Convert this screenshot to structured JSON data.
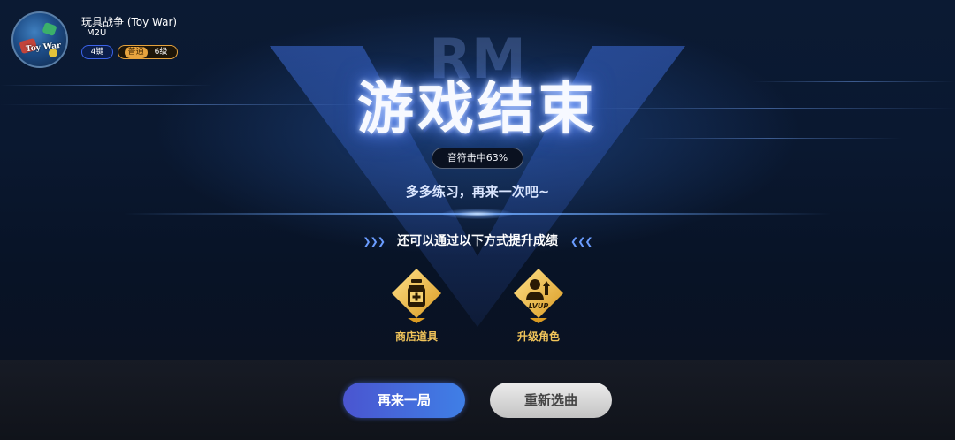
{
  "song": {
    "title": "玩具战争 (Toy War)",
    "artist": "M2U",
    "cover_text": "Toy War",
    "keys_tag": "4键",
    "difficulty_label": "普通",
    "difficulty_level": "6级"
  },
  "result": {
    "title": "游戏结束",
    "hit_rate": "音符击中63%",
    "message": "多多练习，再来一次吧~"
  },
  "tips": {
    "heading": "还可以通过以下方式提升成绩",
    "chevrons_left": "❯❯❯",
    "chevrons_right": "❮❮❮",
    "items": [
      {
        "label": "商店道具",
        "icon": "potion-bottle-icon"
      },
      {
        "label": "升级角色",
        "icon": "level-up-icon",
        "badge_text": "LVUP"
      }
    ]
  },
  "background_logo": "RM",
  "buttons": {
    "retry": "再来一局",
    "reselect": "重新选曲"
  },
  "colors": {
    "accent_gold": "#f1c45a",
    "accent_blue": "#3c63e8",
    "retry_button": "#4a6ad8",
    "reselect_button": "#d6d6d6"
  }
}
